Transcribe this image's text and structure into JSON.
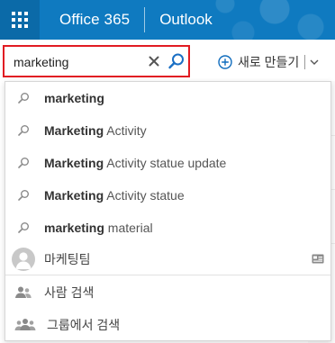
{
  "suitebar": {
    "product": "Office 365",
    "app": "Outlook"
  },
  "search": {
    "value": "marketing"
  },
  "toolbar": {
    "new_label": "새로 만들기"
  },
  "suggestions": [
    {
      "bold": "marketing",
      "rest": ""
    },
    {
      "bold": "Marketing",
      "rest": " Activity"
    },
    {
      "bold": "Marketing",
      "rest": " Activity statue update"
    },
    {
      "bold": "Marketing",
      "rest": " Activity statue"
    },
    {
      "bold": "marketing",
      "rest": " material"
    }
  ],
  "contact": {
    "name": "마케팅팀"
  },
  "actions": {
    "people_search": "사람 검색",
    "group_search": "그룹에서 검색"
  },
  "colors": {
    "suitebar": "#0f7ac0",
    "highlight_border": "#e11b22"
  },
  "icons": [
    "waffle-icon",
    "clear-icon",
    "search-icon",
    "plus-circle-icon",
    "chevron-down-icon",
    "magnifier-icon",
    "avatar-icon",
    "contact-card-icon",
    "person-icon",
    "group-icon"
  ]
}
